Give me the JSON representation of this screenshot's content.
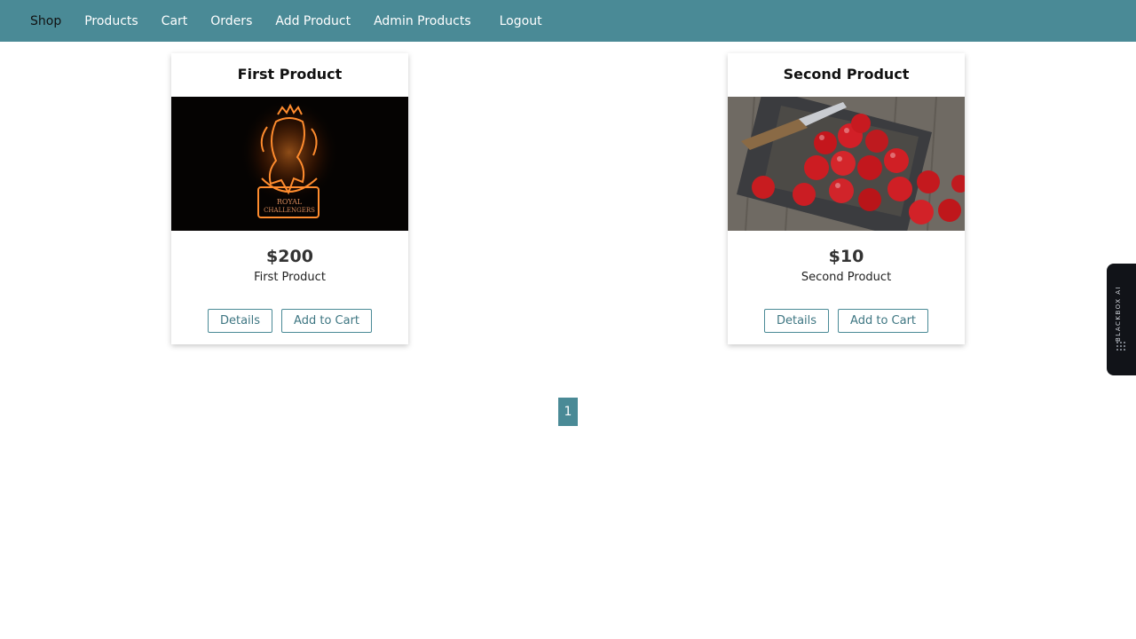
{
  "nav": {
    "items": [
      {
        "label": "Shop",
        "active": true
      },
      {
        "label": "Products"
      },
      {
        "label": "Cart"
      },
      {
        "label": "Orders"
      },
      {
        "label": "Add Product"
      },
      {
        "label": "Admin Products"
      },
      {
        "label": "Logout"
      }
    ]
  },
  "products": [
    {
      "title": "First Product",
      "price": "$200",
      "description": "First Product",
      "image_text_line1": "ROYAL",
      "image_text_line2": "CHALLENGERS",
      "details_label": "Details",
      "cart_label": "Add to Cart"
    },
    {
      "title": "Second Product",
      "price": "$10",
      "description": "Second Product",
      "details_label": "Details",
      "cart_label": "Add to Cart"
    }
  ],
  "pagination": {
    "current": "1"
  },
  "side_widget": {
    "label": "BLACKBOX AI"
  },
  "colors": {
    "accent": "#4a8a96",
    "text": "#222222"
  }
}
